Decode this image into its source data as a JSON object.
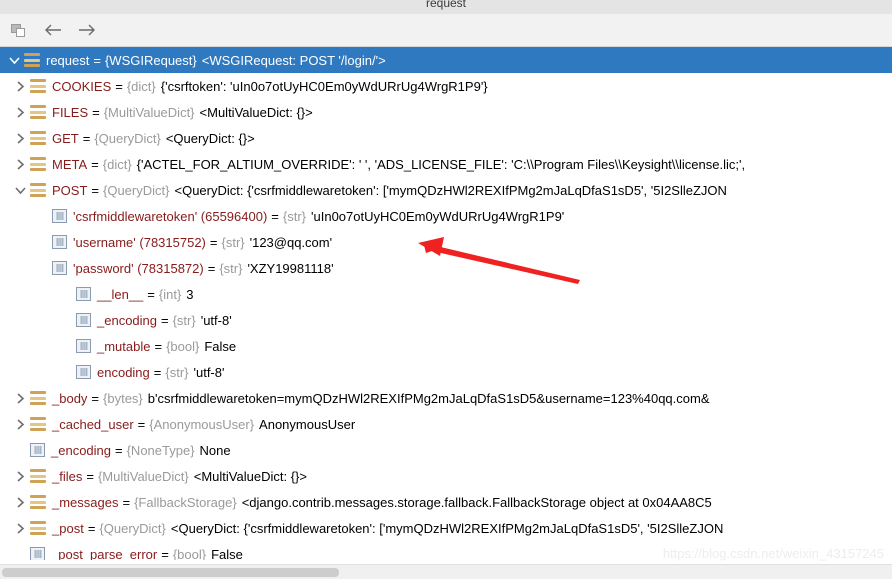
{
  "window": {
    "tab_title": "request",
    "watermark": "https://blog.csdn.net/weixin_43157245"
  },
  "toolbar": {
    "buttons": [
      {
        "name": "copy-icon",
        "tooltip": "Copy"
      },
      {
        "name": "back-arrow-icon",
        "tooltip": "Back"
      },
      {
        "name": "forward-arrow-icon",
        "tooltip": "Forward"
      }
    ]
  },
  "tree": {
    "rows": [
      {
        "id": "request",
        "selected": true,
        "expanded": true,
        "indent": 0,
        "icon": "object-icon",
        "name": "request",
        "eq": "=",
        "type": "{WSGIRequest}",
        "value": "<WSGIRequest: POST '/login/'>"
      },
      {
        "id": "cookies",
        "selected": false,
        "expanded": false,
        "indent": 1,
        "icon": "object-icon",
        "name": "COOKIES",
        "eq": "=",
        "type": "{dict}",
        "value": "{'csrftoken': 'uIn0o7otUyHC0Em0yWdURrUg4WrgR1P9'}"
      },
      {
        "id": "files",
        "selected": false,
        "expanded": false,
        "indent": 1,
        "icon": "object-icon",
        "name": "FILES",
        "eq": "=",
        "type": "{MultiValueDict}",
        "value": "<MultiValueDict: {}>"
      },
      {
        "id": "get",
        "selected": false,
        "expanded": false,
        "indent": 1,
        "icon": "object-icon",
        "name": "GET",
        "eq": "=",
        "type": "{QueryDict}",
        "value": "<QueryDict: {}>"
      },
      {
        "id": "meta",
        "selected": false,
        "expanded": false,
        "indent": 1,
        "icon": "object-icon",
        "name": "META",
        "eq": "=",
        "type": "{dict}",
        "value": "{'ACTEL_FOR_ALTIUM_OVERRIDE': ' ', 'ADS_LICENSE_FILE': 'C:\\\\Program Files\\\\Keysight\\\\license.lic;',"
      },
      {
        "id": "post",
        "selected": false,
        "expanded": true,
        "indent": 1,
        "icon": "object-icon",
        "name": "POST",
        "eq": "=",
        "type": "{QueryDict}",
        "value": "<QueryDict: {'csrfmiddlewaretoken': ['mymQDzHWl2REXIfPMg2mJaLqDfaS1sD5', '5I2SlleZJON"
      },
      {
        "id": "csrfmiddlewaretoken",
        "selected": false,
        "expanded": null,
        "indent": 2,
        "icon": "primitive-icon",
        "name": "'csrfmiddlewaretoken' (65596400)",
        "eq": "=",
        "type": "{str}",
        "value": "'uIn0o7otUyHC0Em0yWdURrUg4WrgR1P9'"
      },
      {
        "id": "username",
        "selected": false,
        "expanded": null,
        "indent": 2,
        "icon": "primitive-icon",
        "name": "'username' (78315752)",
        "eq": "=",
        "type": "{str}",
        "value": "'123@qq.com'"
      },
      {
        "id": "password",
        "selected": false,
        "expanded": null,
        "indent": 2,
        "icon": "primitive-icon",
        "name": "'password' (78315872)",
        "eq": "=",
        "type": "{str}",
        "value": "'XZY19981118'"
      },
      {
        "id": "len",
        "selected": false,
        "expanded": null,
        "indent": 3,
        "icon": "primitive-icon",
        "name": "__len__",
        "eq": "=",
        "type": "{int}",
        "value": "3"
      },
      {
        "id": "post-encoding",
        "selected": false,
        "expanded": null,
        "indent": 3,
        "icon": "primitive-icon",
        "name": "_encoding",
        "eq": "=",
        "type": "{str}",
        "value": "'utf-8'"
      },
      {
        "id": "mutable",
        "selected": false,
        "expanded": null,
        "indent": 3,
        "icon": "primitive-icon",
        "name": "_mutable",
        "eq": "=",
        "type": "{bool}",
        "value": "False"
      },
      {
        "id": "encoding",
        "selected": false,
        "expanded": null,
        "indent": 3,
        "icon": "primitive-icon",
        "name": "encoding",
        "eq": "=",
        "type": "{str}",
        "value": "'utf-8'"
      },
      {
        "id": "body",
        "selected": false,
        "expanded": false,
        "indent": 1,
        "icon": "object-icon",
        "name": "_body",
        "eq": "=",
        "type": "{bytes}",
        "value": "b'csrfmiddlewaretoken=mymQDzHWl2REXIfPMg2mJaLqDfaS1sD5&username=123%40qq.com&"
      },
      {
        "id": "cached-user",
        "selected": false,
        "expanded": false,
        "indent": 1,
        "icon": "object-icon",
        "name": "_cached_user",
        "eq": "=",
        "type": "{AnonymousUser}",
        "value": "AnonymousUser"
      },
      {
        "id": "req-encoding",
        "selected": false,
        "expanded": null,
        "indent": 1,
        "icon": "primitive-icon",
        "name": "_encoding",
        "eq": "=",
        "type": "{NoneType}",
        "value": "None"
      },
      {
        "id": "req-files",
        "selected": false,
        "expanded": false,
        "indent": 1,
        "icon": "object-icon",
        "name": "_files",
        "eq": "=",
        "type": "{MultiValueDict}",
        "value": "<MultiValueDict: {}>"
      },
      {
        "id": "messages",
        "selected": false,
        "expanded": false,
        "indent": 1,
        "icon": "object-icon",
        "name": "_messages",
        "eq": "=",
        "type": "{FallbackStorage}",
        "value": "<django.contrib.messages.storage.fallback.FallbackStorage object at 0x04AA8C5"
      },
      {
        "id": "post-private",
        "selected": false,
        "expanded": false,
        "indent": 1,
        "icon": "object-icon",
        "name": "_post",
        "eq": "=",
        "type": "{QueryDict}",
        "value": "<QueryDict: {'csrfmiddlewaretoken': ['mymQDzHWl2REXIfPMg2mJaLqDfaS1sD5', '5I2SlleZJON"
      },
      {
        "id": "post-parse-error",
        "selected": false,
        "expanded": null,
        "indent": 1,
        "icon": "primitive-icon",
        "name": "_post_parse_error",
        "eq": "=",
        "type": "{bool}",
        "value": "False"
      }
    ]
  },
  "annotation": {
    "color": "#ef2121",
    "target_row_id": "username"
  },
  "scrollbar": {
    "orientation": "horizontal",
    "thumb_fraction": 0.38
  }
}
